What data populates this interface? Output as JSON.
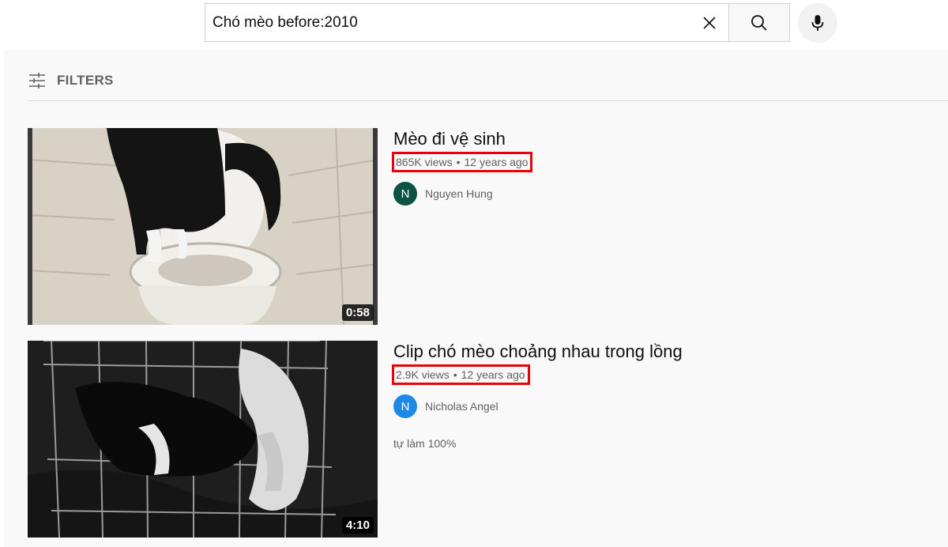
{
  "search": {
    "query": "Chó mèo before:2010",
    "clear_icon": "close-icon",
    "search_icon": "search-icon",
    "mic_icon": "microphone-icon"
  },
  "filters": {
    "icon": "tune-icon",
    "label": "FILTERS"
  },
  "results": [
    {
      "title": "Mèo đi vệ sinh",
      "views": "865K views",
      "separator": "•",
      "age": "12 years ago",
      "channel": "Nguyen Hung",
      "avatar_letter": "N",
      "avatar_color": "#0b5345",
      "duration": "0:58",
      "description": ""
    },
    {
      "title": "Clip chó mèo choảng nhau trong lồng",
      "views": "2.9K views",
      "separator": "•",
      "age": "12 years ago",
      "channel": "Nicholas Angel",
      "avatar_letter": "N",
      "avatar_color": "#1e88e5",
      "duration": "4:10",
      "description": "tự làm 100%"
    }
  ],
  "colors": {
    "highlight_box": "#e8000d",
    "page_background": "#f9f9f9",
    "secondary_text": "#606060"
  }
}
